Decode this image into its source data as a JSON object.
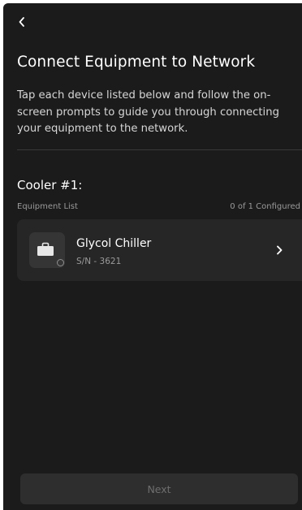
{
  "header": {
    "back_icon": "chevron-left-icon",
    "title": "Connect Equipment to Network",
    "description": "Tap each device listed below and follow the on-screen prompts to guide you through connecting your equipment to the network."
  },
  "section": {
    "title": "Cooler #1:",
    "list_label": "Equipment List",
    "configured_count": "0 of 1 Configured"
  },
  "devices": [
    {
      "name": "Glycol Chiller",
      "serial": "S/N - 3621",
      "icon": "briefcase-icon",
      "status_icon": "status-dot-icon",
      "chevron_icon": "chevron-right-icon"
    }
  ],
  "footer": {
    "next_label": "Next",
    "next_enabled": false
  },
  "colors": {
    "background": "#1b1b1b",
    "card": "#262626",
    "icon_box": "#353535",
    "text_primary": "#ffffff",
    "text_secondary": "#9a9a9a",
    "button_disabled_bg": "#2e2e2e",
    "button_disabled_text": "#6e6e6e"
  }
}
